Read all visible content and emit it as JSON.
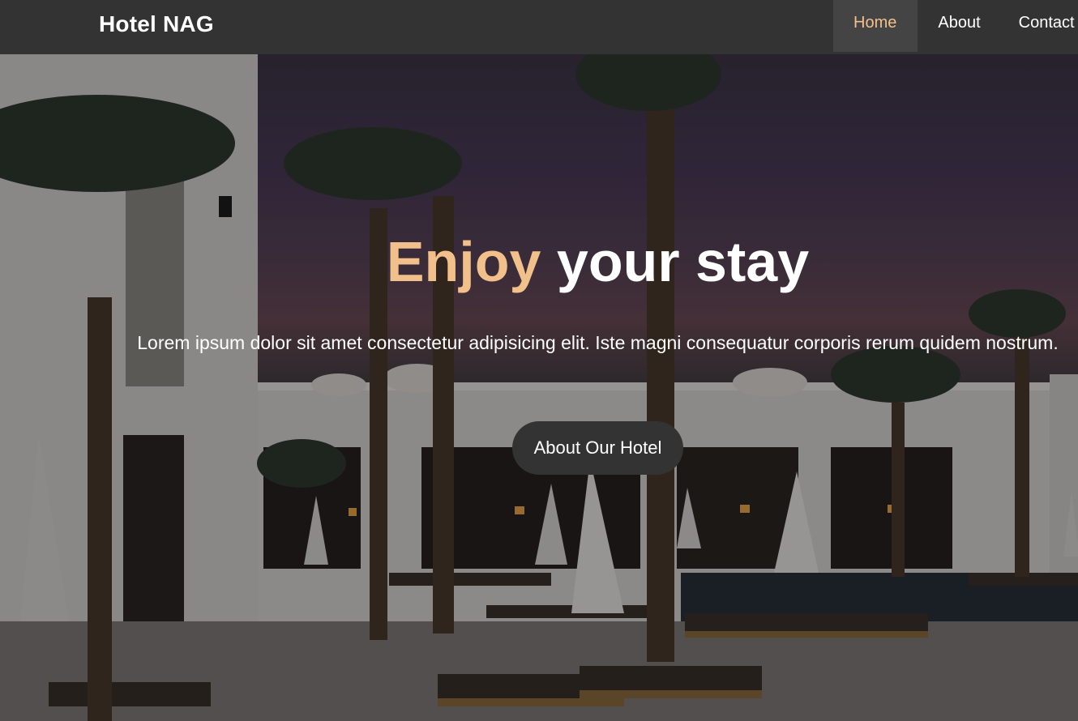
{
  "navbar": {
    "brand": "Hotel NAG",
    "links": [
      {
        "label": "Home",
        "active": true
      },
      {
        "label": "About",
        "active": false
      },
      {
        "label": "Contact",
        "active": false
      }
    ]
  },
  "hero": {
    "title_accent": "Enjoy",
    "title_rest": "your stay",
    "description": "Lorem ipsum dolor sit amet consectetur adipisicing elit. Iste magni consequatur corporis rerum quidem nostrum.",
    "button_label": "About Our Hotel",
    "background_image": "hotel-pool-palm-trees-dusk"
  },
  "colors": {
    "navbar_bg": "#333333",
    "nav_active_bg": "#444444",
    "accent": "#f2c08a",
    "button_bg": "#333333",
    "text": "#ffffff"
  }
}
